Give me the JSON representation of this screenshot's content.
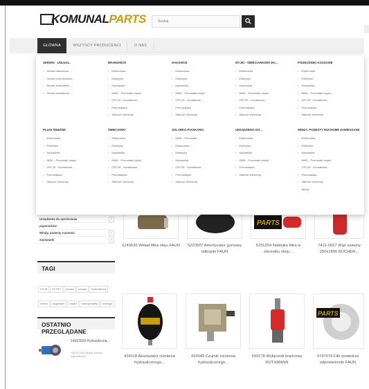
{
  "header": {
    "logo_text_a": "KOMUNAL",
    "logo_text_b": "PARTS",
    "search_placeholder": "Szukaj"
  },
  "nav": {
    "items": [
      {
        "label": "GŁÓWNA",
        "active": true
      },
      {
        "label": "WSZYSCY PRODUCENCI",
        "active": false
      },
      {
        "label": "O NAS",
        "active": false
      }
    ]
  },
  "mega_menu": {
    "columns": [
      {
        "title": "SERWIS - USŁUGI...",
        "items": [
          "Serwis hakowców -...",
          "Serwis podnośników...",
          "Serwis śmieciarek -...",
          "Serwis zamiatarek -..."
        ]
      },
      {
        "title": "BRAMOWCE",
        "items": [
          "Elektronika",
          "Elektryka",
          "Hydraulika",
          "INNE - Pozostałe części",
          "OPCJE - Dodatkowe...",
          "Pneumatyka",
          "Stalowe elementy"
        ]
      },
      {
        "title": "HAKOWCE",
        "items": [
          "Elektronika",
          "Elektryka",
          "Hydraulika",
          "INNE - Pozostałe części",
          "OPCJE - Dodatkowe...",
          "Pneumatyka",
          "Stalowe elementy"
        ]
      },
      {
        "title": "MYJKI - ŚMIECIARKOMYJKI...",
        "items": [
          "Elektronika",
          "Elektryka",
          "Hydraulika",
          "INNE - Pozostałe części",
          "OPCJE - Dodatkowe...",
          "Pneumatyka",
          "Stalowe elementy"
        ]
      },
      {
        "title": "PODNOŚNIKI KOSZOWE",
        "items": [
          "Elektronika",
          "Elektryka",
          "Hydraulika",
          "INNE - Pozostałe części",
          "OPCJE - Dodatkowe...",
          "Pneumatyka",
          "Stalowe elementy"
        ]
      },
      {
        "title": "PŁUGI ŚNIEŻNE",
        "items": [
          "Elektronika",
          "Elektryka",
          "Hydraulika",
          "INNE - Pozostałe części",
          "OPCJE - Dodatkowe...",
          "Pneumatyka",
          "Stalowe elementy"
        ]
      },
      {
        "title": "ŚMIECIARKI",
        "items": [
          "Elektronika",
          "Elektryka",
          "Hydraulika",
          "INNE - Pozostałe części",
          "OPCJE - Dodatkowe...",
          "Pneumatyka",
          "Stalowe elementy"
        ]
      },
      {
        "title": "SOLARKO-PIASKARKI",
        "items": [
          "INNE - Pozostałe...",
          "Elektronika",
          "Elektryka",
          "Hydraulika",
          "OPCJE - Dodatkowe...",
          "Pneumatyka",
          "Stalowe elementy"
        ]
      },
      {
        "title": "URZĄDZENIA DO...",
        "items": [
          "Elektronika",
          "Elektryka",
          "Hydraulika",
          "INNE - Pozostałe części",
          "Pneumatyka",
          "Stalowe elementy"
        ]
      },
      {
        "title": "WINDY, PODESTY RUCHOME ZAWIESZANE",
        "items": [
          "Elektronika",
          "Elektryka",
          "Hydraulika",
          "INNE - Pozostałe części",
          "OPCJE - Dodatkowe...",
          "Pneumatyka",
          "Stalowe elementy",
          "Windy"
        ]
      }
    ]
  },
  "sidebar": {
    "categories": [
      "Urządzenia do opróżniania",
      "pojemników",
      "Windy, podesty ruchome",
      "Zamiatarki"
    ],
    "tags_title": "TAGI",
    "tags": [
      "HYVA",
      "FILTRY",
      "pompa",
      "pompa",
      "hydrauliczna",
      "serwis",
      "oryginalne",
      "części",
      "autoryzowany",
      "obsługa"
    ],
    "recent_title": "OSTATNIO PRZEGLĄDANE",
    "recent_item": {
      "title": "14563028 Hydrauliczna...",
      "desc": "146 63 028 Zabezp pompa hydrauliczna..."
    }
  },
  "products": [
    {
      "caption": "5240635 Wkład filtra oleju FAUN"
    },
    {
      "caption": "5220507 Amortyzator gumowy odbojnik FAUN"
    },
    {
      "caption": "5231204 Naklejka filtra w zbiorniku oleju..."
    },
    {
      "caption": "7411-0027 Wąż ssawny 250x1800 BUCHER..."
    },
    {
      "caption": "434118 Akumulator ciśnienia hydraulicznego..."
    },
    {
      "caption": "433049 Czujnik ciśnienia hydraulicznego..."
    },
    {
      "caption": "540178 Wyłącznik krańcowy RUTHMANN"
    },
    {
      "caption": "0747076 Filtr powietrza odpowietrznik FAUN"
    }
  ],
  "colors": {
    "nav_active": "#2f2f2f",
    "brand_gold": "#c89a10",
    "accent_red": "#d42a2a"
  }
}
